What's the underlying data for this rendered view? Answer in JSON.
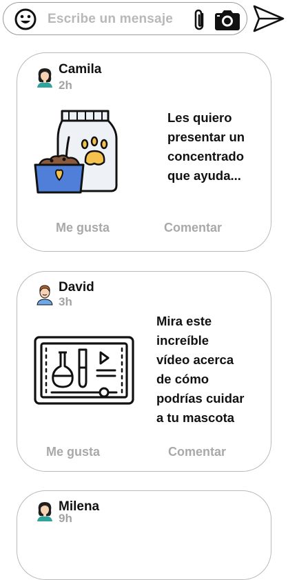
{
  "composer": {
    "placeholder": "Escribe un mensaje",
    "icons": [
      "smiley-icon",
      "paperclip-icon",
      "camera-icon",
      "send-icon"
    ]
  },
  "posts": [
    {
      "author": "Camila",
      "time": "2h",
      "text": "Les quiero\npresentar un\nconcentrado\nque ayuda...",
      "image": "pet-food-bag-icon",
      "like_label": "Me gusta",
      "comment_label": "Comentar"
    },
    {
      "author": "David",
      "time": "3h",
      "text": "Mira este\nincreíble\nvídeo acerca\nde cómo\npodrías cuidar\na tu mascota",
      "image": "science-video-icon",
      "like_label": "Me gusta",
      "comment_label": "Comentar"
    },
    {
      "author": "Milena",
      "time": "9h"
    }
  ]
}
